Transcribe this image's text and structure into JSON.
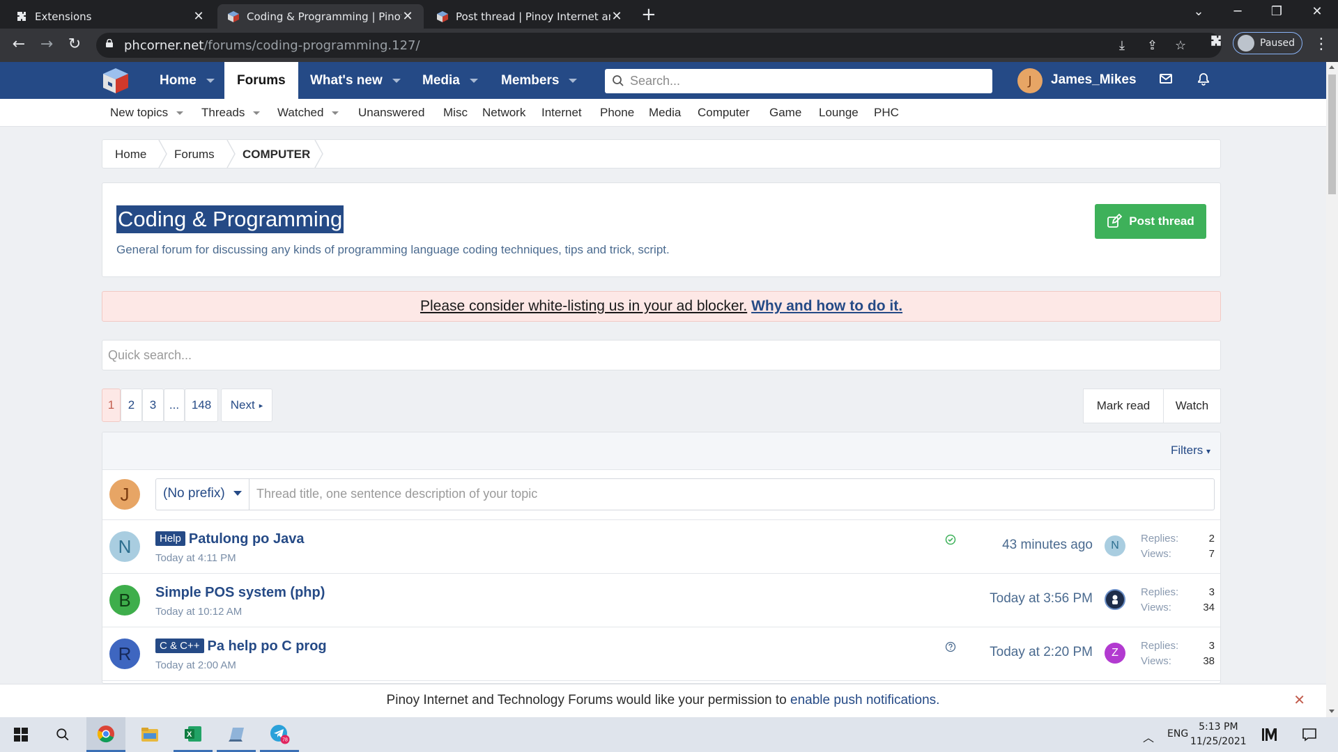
{
  "browser": {
    "tabs": [
      {
        "title": "Extensions",
        "icon": "puzzle-icon",
        "active": false
      },
      {
        "title": "Coding & Programming | Pinoy I",
        "icon": "phc-favicon",
        "active": true
      },
      {
        "title": "Post thread | Pinoy Internet and",
        "icon": "phc-favicon",
        "active": false
      }
    ],
    "url_host": "phcorner.net",
    "url_path": "/forums/coding-programming.127/",
    "profile_status": "Paused"
  },
  "site": {
    "nav": [
      {
        "label": "Home",
        "has_menu": true,
        "selected": false
      },
      {
        "label": "Forums",
        "has_menu": false,
        "selected": true
      },
      {
        "label": "What's new",
        "has_menu": true,
        "selected": false
      },
      {
        "label": "Media",
        "has_menu": true,
        "selected": false
      },
      {
        "label": "Members",
        "has_menu": true,
        "selected": false
      }
    ],
    "search_placeholder": "Search...",
    "user": {
      "name": "James_Mikes",
      "initial": "J"
    },
    "subnav": [
      "New topics",
      "Threads",
      "Watched",
      "Unanswered",
      "Misc",
      "Network",
      "Internet",
      "Phone",
      "Media",
      "Computer",
      "Game",
      "Lounge",
      "PHC"
    ],
    "colors": {
      "brand": "#254a86",
      "accent_green": "#3eb15a",
      "notice_bg": "#fde8e6"
    }
  },
  "breadcrumb": [
    "Home",
    "Forums",
    "COMPUTER"
  ],
  "forum": {
    "title": "Coding & Programming",
    "description": "General forum for discussing any kinds of programming language coding techniques, tips and trick, script.",
    "post_button": "Post thread"
  },
  "adblock_notice": {
    "text": "Please consider white-listing us in your ad blocker.",
    "link": "Why and how to do it."
  },
  "quick_search_placeholder": "Quick search...",
  "pagination": {
    "pages": [
      "1",
      "2",
      "3",
      "...",
      "148"
    ],
    "current": "1",
    "next": "Next"
  },
  "actions": {
    "mark_read": "Mark read",
    "watch": "Watch"
  },
  "filters_label": "Filters",
  "new_thread": {
    "prefix": "(No prefix)",
    "placeholder": "Thread title, one sentence description of your topic",
    "avatar_initial": "J"
  },
  "threads": [
    {
      "prefix": "Help",
      "title": "Patulong po Java",
      "date": "Today at 4:11 PM",
      "avatar": "N",
      "status_icon": "check-circle-icon",
      "last_post": "43 minutes ago",
      "last_avatar": "N",
      "replies_label": "Replies:",
      "replies": "2",
      "views_label": "Views:",
      "views": "7"
    },
    {
      "prefix": "",
      "title": "Simple POS system (php)",
      "date": "Today at 10:12 AM",
      "avatar": "B",
      "status_icon": "",
      "last_post": "Today at 3:56 PM",
      "last_avatar": "",
      "replies_label": "Replies:",
      "replies": "3",
      "views_label": "Views:",
      "views": "34"
    },
    {
      "prefix": "C & C++",
      "title": "Pa help po C prog",
      "date": "Today at 2:00 AM",
      "avatar": "R",
      "status_icon": "question-circle-icon",
      "last_post": "Today at 2:20 PM",
      "last_avatar": "Z",
      "replies_label": "Replies:",
      "replies": "3",
      "views_label": "Views:",
      "views": "38"
    }
  ],
  "push_notice": {
    "text": "Pinoy Internet and Technology Forums would like your permission to",
    "link": "enable push notifications."
  },
  "taskbar": {
    "language": "ENG",
    "time": "5:13 PM",
    "date": "11/25/2021",
    "telegram_badge": "78"
  }
}
